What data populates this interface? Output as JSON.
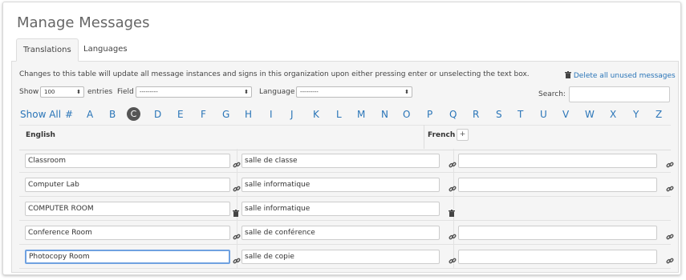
{
  "page": {
    "title": "Manage Messages"
  },
  "tabs": [
    {
      "label": "Translations"
    },
    {
      "label": "Languages"
    }
  ],
  "notice": {
    "text": "Changes to this table will update all message instances and signs in this organization upon either pressing enter or unselecting the text box.",
    "delete_label": "Delete all unused messages"
  },
  "filters": {
    "show_label": "Show",
    "show_value": "100",
    "entries_label": "entries",
    "field_label": "Field",
    "field_value": "---------",
    "language_label": "Language",
    "language_value": "---------",
    "search_label": "Search:"
  },
  "alphabet": [
    "Show All",
    "#",
    "A",
    "B",
    "C",
    "D",
    "E",
    "F",
    "G",
    "H",
    "I",
    "J",
    "K",
    "L",
    "M",
    "N",
    "O",
    "P",
    "Q",
    "R",
    "S",
    "T",
    "U",
    "V",
    "W",
    "X",
    "Y",
    "Z"
  ],
  "alphabet_active": "C",
  "table": {
    "col_english": "English",
    "col_french": "French",
    "add_label": "+",
    "rows": [
      {
        "english": "Classroom",
        "french": "salle de classe",
        "en_icon": "link-icon",
        "fr_icon": "link-icon",
        "extra": true
      },
      {
        "english": "Computer Lab",
        "french": "salle informatique",
        "en_icon": "link-icon",
        "fr_icon": "link-icon",
        "extra": true
      },
      {
        "english": "COMPUTER ROOM",
        "french": "salle informatique",
        "en_icon": "trash-icon",
        "fr_icon": "trash-icon",
        "extra": false
      },
      {
        "english": "Conference Room",
        "french": "salle de conférence",
        "en_icon": "link-icon",
        "fr_icon": "link-icon",
        "extra": true
      },
      {
        "english": "Photocopy Room",
        "french": "salle de copie",
        "en_icon": "link-icon",
        "fr_icon": "link-icon",
        "extra": true
      }
    ]
  },
  "colors": {
    "link": "#2a75b8",
    "focus": "#6fa1e0",
    "panel": "#f5f5f5"
  }
}
